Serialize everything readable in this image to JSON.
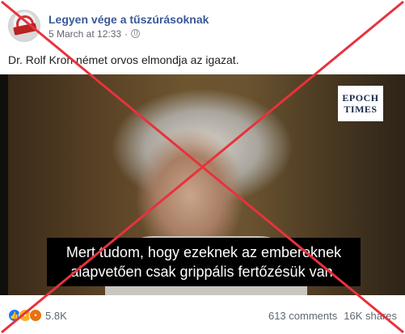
{
  "post": {
    "page_name": "Legyen vége a tűszúrásoknak",
    "timestamp": "5 March at 12:33",
    "separator": "·",
    "text": "Dr. Rolf Kron német orvos elmondja az igazat."
  },
  "video": {
    "logo_line1": "EPOCH",
    "logo_line2": "TIMES",
    "subtitle_line1": "Mert tudom, hogy ezeknek az embereknek",
    "subtitle_line2": "alapvetően csak grippális fertőzésük van."
  },
  "footer": {
    "reaction_count": "5.8K",
    "comments": "613 comments",
    "shares": "16K shares"
  },
  "colors": {
    "cross": "#e8323c",
    "page_name": "#385898"
  },
  "icons": {
    "privacy": "globe-icon",
    "reactions": [
      "like-icon",
      "wow-icon",
      "angry-icon"
    ]
  }
}
